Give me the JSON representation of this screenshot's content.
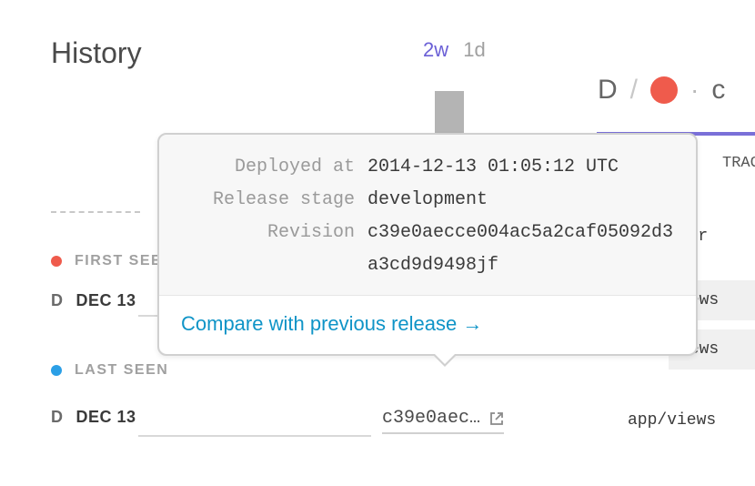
{
  "header": {
    "title": "History",
    "timerange_active": "2w",
    "timerange_inactive": "1d"
  },
  "right_header": {
    "letter": "D",
    "content": "c",
    "trace_fragment": "TRAC"
  },
  "code_fragments": {
    "err": ":Err",
    "ews1": "iews",
    "ews2": "iews",
    "path": "app/views"
  },
  "sections": {
    "first_seen_label": "FIRST SEEN",
    "last_seen_label": "LAST SEEN",
    "badge": "D",
    "first_seen_date": "DEC 13",
    "last_seen_date": "DEC 13"
  },
  "tooltip": {
    "deployed_at_key": "Deployed at",
    "deployed_at_val": "2014-12-13 01:05:12 UTC",
    "release_stage_key": "Release stage",
    "release_stage_val": "development",
    "revision_key": "Revision",
    "revision_val": "c39e0aecce004ac5a2caf05092d3a3cd9d9498jf",
    "compare_link": "Compare with previous release →"
  },
  "revision_short": "c39e0aec…"
}
